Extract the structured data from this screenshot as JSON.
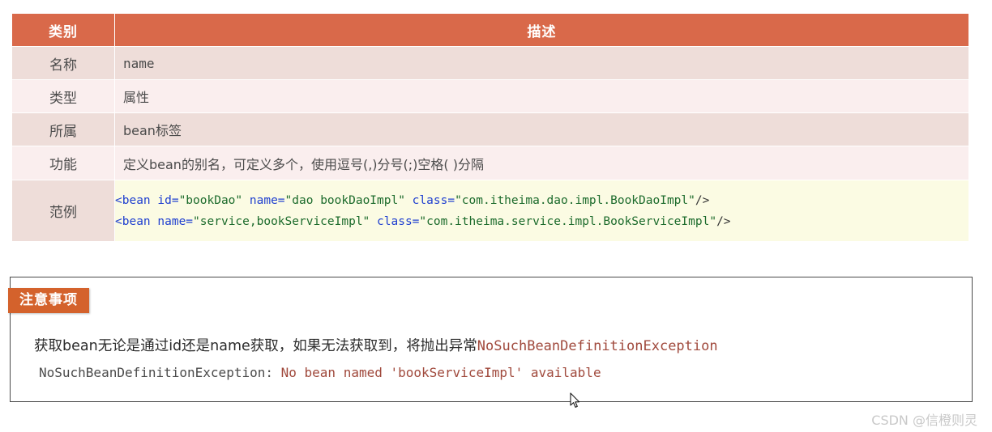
{
  "table": {
    "headers": {
      "category": "类别",
      "description": "描述"
    },
    "rows": [
      {
        "label": "名称",
        "value": "name"
      },
      {
        "label": "类型",
        "value": "属性"
      },
      {
        "label": "所属",
        "value": "bean标签"
      },
      {
        "label": "功能",
        "value": "定义bean的别名，可定义多个，使用逗号(,)分号(;)空格( )分隔"
      },
      {
        "label": "范例",
        "value": ""
      }
    ],
    "example": {
      "line1": {
        "open": "<bean",
        "attr_id": " id=",
        "val_id": "\"bookDao\"",
        "attr_name": " name=",
        "val_name": "\"dao bookDaoImpl\"",
        "attr_class": " class=",
        "val_class": "\"com.itheima.dao.impl.BookDaoImpl\"",
        "close": "/>"
      },
      "line2": {
        "open": "<bean",
        "attr_name": " name=",
        "val_name": "\"service,bookServiceImpl\"",
        "attr_class": " class=",
        "val_class": "\"com.itheima.service.impl.BookServiceImpl\"",
        "close": "/>"
      }
    },
    "colors": {
      "header_bg": "#d9694a",
      "row_dark_bg": "#eeddd9",
      "row_light_bg": "#faeeee",
      "code_bg": "#fbfbe3",
      "tag_color": "#2040d0",
      "string_color": "#1c6b2c"
    }
  },
  "notice": {
    "badge": "注意事项",
    "line1_prefix": "获取bean无论是通过id还是name获取，如果无法获取到，将抛出异常",
    "line1_exception": "NoSuchBeanDefinitionException",
    "line2_prefix": "NoSuchBeanDefinitionException: ",
    "line2_message": "No bean named 'bookServiceImpl' available",
    "colors": {
      "badge_bg": "#d4622c",
      "exception_color": "#a0493c",
      "border_color": "#4a4a4a"
    }
  },
  "watermark": {
    "text": "CSDN @信橙则灵"
  }
}
